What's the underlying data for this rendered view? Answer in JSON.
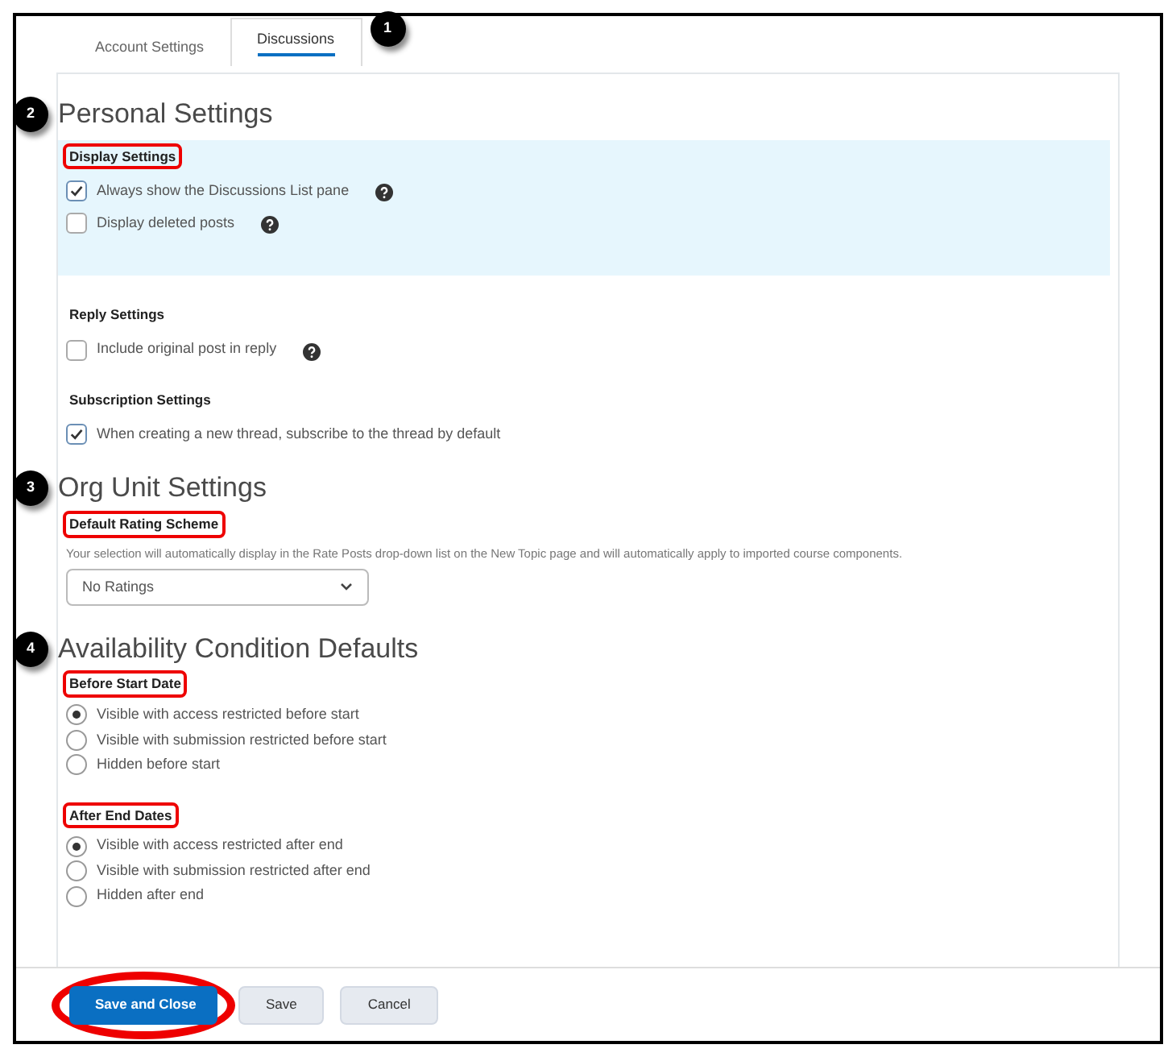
{
  "tabs": [
    {
      "label": "Account Settings",
      "selected": false
    },
    {
      "label": "Discussions",
      "selected": true,
      "callout": "1"
    }
  ],
  "sections": [
    {
      "callout": "2",
      "title": "Personal Settings",
      "groups": [
        {
          "label": "Display Settings",
          "highlighted": true,
          "shaded": true,
          "kind": "checkboxes",
          "items": [
            {
              "label": "Always show the Discussions List pane",
              "checked": true,
              "help": true
            },
            {
              "label": "Display deleted posts",
              "checked": false,
              "help": true
            }
          ]
        },
        {
          "label": "Reply Settings",
          "highlighted": false,
          "shaded": false,
          "kind": "checkboxes",
          "items": [
            {
              "label": "Include original post in reply",
              "checked": false,
              "help": true
            }
          ]
        },
        {
          "label": "Subscription Settings",
          "highlighted": false,
          "shaded": false,
          "kind": "checkboxes",
          "items": [
            {
              "label": "When creating a new thread, subscribe to the thread by default",
              "checked": true,
              "help": false
            }
          ]
        }
      ]
    },
    {
      "callout": "3",
      "title": "Org Unit Settings",
      "groups": [
        {
          "label": "Default Rating Scheme",
          "highlighted": true,
          "shaded": false,
          "kind": "select",
          "description": "Your selection will automatically display in the Rate Posts drop-down list on the New Topic page and will automatically apply to imported course components.",
          "value": "No Ratings"
        }
      ]
    },
    {
      "callout": "4",
      "title": "Availability Condition Defaults",
      "groups": [
        {
          "label": "Before Start Date",
          "highlighted": true,
          "shaded": false,
          "kind": "radios",
          "items": [
            {
              "label": "Visible with access restricted before start",
              "selected": true
            },
            {
              "label": "Visible with submission restricted before start",
              "selected": false
            },
            {
              "label": "Hidden before start",
              "selected": false
            }
          ]
        },
        {
          "label": "After End Dates",
          "highlighted": true,
          "shaded": false,
          "kind": "radios",
          "items": [
            {
              "label": "Visible with access restricted after end",
              "selected": true
            },
            {
              "label": "Visible with submission restricted after end",
              "selected": false
            },
            {
              "label": "Hidden after end",
              "selected": false
            }
          ]
        }
      ]
    }
  ],
  "buttons": [
    {
      "label": "Save and Close",
      "primary": true,
      "circled": true
    },
    {
      "label": "Save",
      "primary": false,
      "circled": false
    },
    {
      "label": "Cancel",
      "primary": false,
      "circled": false
    }
  ]
}
